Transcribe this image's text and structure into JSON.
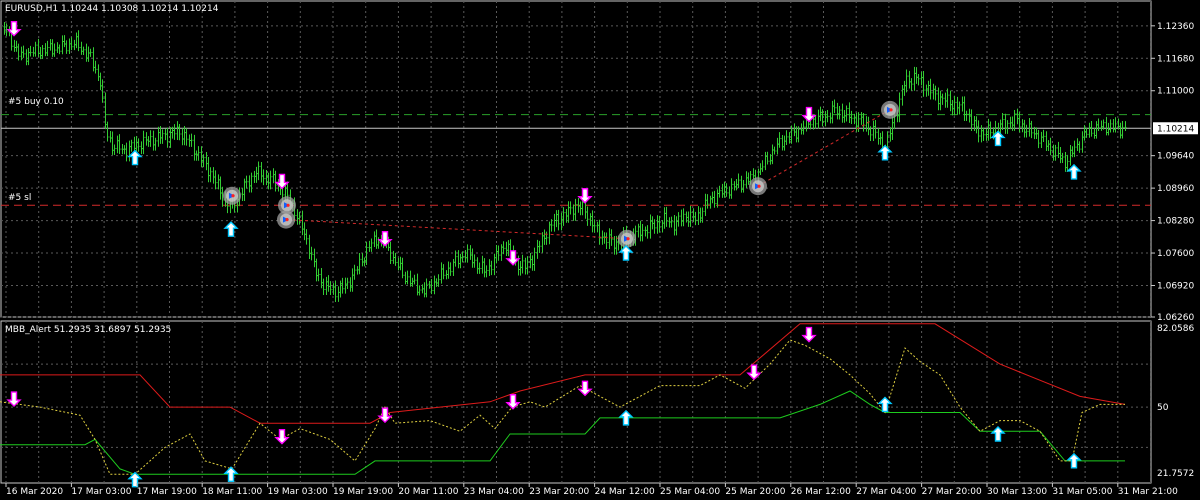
{
  "colors": {
    "background": "#000000",
    "grid": "#5a5a5a",
    "candles": "#33cc33",
    "buy_level": "#2aa02a",
    "sl_level": "#d42a2a",
    "price_line": "#c8c8c8",
    "upper_band": "#dd1b1b",
    "lower_band": "#1ecb1e",
    "signal_line": "#e0d040",
    "up_arrow": "#00c8ff",
    "down_arrow": "#ff00ff"
  },
  "chart_data": [
    {
      "type": "candlestick",
      "title": "EURUSD,H1  1.10244 1.10308 1.10214 1.10214",
      "current_price": 1.10214,
      "current_price_label": "1.10214",
      "ylim": [
        1.0626,
        1.1288
      ],
      "yticks": [
        1.0626,
        1.0692,
        1.076,
        1.0828,
        1.0896,
        1.0964,
        1.11,
        1.1168,
        1.1236
      ],
      "ytick_labels": [
        "1.06260",
        "1.06920",
        "1.07600",
        "1.08280",
        "1.08960",
        "1.09640",
        "1.11000",
        "1.11680",
        "1.12360"
      ],
      "xticks": [
        "16 Mar 2020",
        "17 Mar 03:00",
        "17 Mar 19:00",
        "18 Mar 11:00",
        "19 Mar 03:00",
        "19 Mar 19:00",
        "20 Mar 11:00",
        "23 Mar 04:00",
        "23 Mar 20:00",
        "24 Mar 12:00",
        "25 Mar 04:00",
        "25 Mar 20:00",
        "26 Mar 12:00",
        "27 Mar 04:00",
        "27 Mar 20:00",
        "30 Mar 13:00",
        "31 Mar 05:00",
        "31 Mar 21:00"
      ],
      "levels": [
        {
          "label": "#5 buy 0.10",
          "value": 1.105
        },
        {
          "label": "#5 sl",
          "value": 1.086
        }
      ],
      "close_path": [
        [
          0,
          1.124
        ],
        [
          10,
          1.121
        ],
        [
          20,
          1.117
        ],
        [
          30,
          1.118
        ],
        [
          45,
          1.1185
        ],
        [
          60,
          1.119
        ],
        [
          75,
          1.12
        ],
        [
          90,
          1.117
        ],
        [
          100,
          1.112
        ],
        [
          105,
          1.102
        ],
        [
          112,
          1.0985
        ],
        [
          125,
          1.0975
        ],
        [
          140,
          1.099
        ],
        [
          155,
          1.1
        ],
        [
          170,
          1.101
        ],
        [
          180,
          1.1015
        ],
        [
          190,
          1.099
        ],
        [
          200,
          1.096
        ],
        [
          210,
          1.093
        ],
        [
          220,
          1.089
        ],
        [
          228,
          1.086
        ],
        [
          235,
          1.087
        ],
        [
          245,
          1.09
        ],
        [
          255,
          1.093
        ],
        [
          265,
          1.092
        ],
        [
          275,
          1.091
        ],
        [
          283,
          1.089
        ],
        [
          292,
          1.086
        ],
        [
          300,
          1.082
        ],
        [
          308,
          1.078
        ],
        [
          315,
          1.072
        ],
        [
          325,
          1.069
        ],
        [
          335,
          1.068
        ],
        [
          345,
          1.069
        ],
        [
          355,
          1.072
        ],
        [
          365,
          1.076
        ],
        [
          375,
          1.079
        ],
        [
          385,
          1.078
        ],
        [
          395,
          1.074
        ],
        [
          405,
          1.071
        ],
        [
          415,
          1.069
        ],
        [
          425,
          1.068
        ],
        [
          435,
          1.07
        ],
        [
          445,
          1.072
        ],
        [
          455,
          1.074
        ],
        [
          465,
          1.076
        ],
        [
          475,
          1.074
        ],
        [
          485,
          1.072
        ],
        [
          495,
          1.075
        ],
        [
          505,
          1.078
        ],
        [
          515,
          1.074
        ],
        [
          525,
          1.073
        ],
        [
          535,
          1.076
        ],
        [
          545,
          1.08
        ],
        [
          555,
          1.083
        ],
        [
          565,
          1.084
        ],
        [
          575,
          1.086
        ],
        [
          585,
          1.085
        ],
        [
          595,
          1.081
        ],
        [
          605,
          1.079
        ],
        [
          615,
          1.078
        ],
        [
          625,
          1.079
        ],
        [
          635,
          1.08
        ],
        [
          645,
          1.081
        ],
        [
          655,
          1.082
        ],
        [
          665,
          1.083
        ],
        [
          675,
          1.082
        ],
        [
          685,
          1.084
        ],
        [
          695,
          1.083
        ],
        [
          705,
          1.086
        ],
        [
          715,
          1.088
        ],
        [
          725,
          1.089
        ],
        [
          735,
          1.09
        ],
        [
          745,
          1.091
        ],
        [
          755,
          1.092
        ],
        [
          765,
          1.095
        ],
        [
          775,
          1.098
        ],
        [
          785,
          1.1
        ],
        [
          795,
          1.101
        ],
        [
          805,
          1.103
        ],
        [
          815,
          1.104
        ],
        [
          825,
          1.1045
        ],
        [
          835,
          1.106
        ],
        [
          845,
          1.105
        ],
        [
          855,
          1.104
        ],
        [
          865,
          1.103
        ],
        [
          875,
          1.101
        ],
        [
          885,
          1.098
        ],
        [
          895,
          1.105
        ],
        [
          905,
          1.112
        ],
        [
          915,
          1.113
        ],
        [
          925,
          1.111
        ],
        [
          935,
          1.109
        ],
        [
          945,
          1.108
        ],
        [
          955,
          1.107
        ],
        [
          965,
          1.106
        ],
        [
          975,
          1.102
        ],
        [
          985,
          1.101
        ],
        [
          995,
          1.102
        ],
        [
          1005,
          1.103
        ],
        [
          1015,
          1.104
        ],
        [
          1025,
          1.102
        ],
        [
          1035,
          1.101
        ],
        [
          1045,
          1.099
        ],
        [
          1055,
          1.097
        ],
        [
          1065,
          1.095
        ],
        [
          1075,
          1.098
        ],
        [
          1085,
          1.101
        ],
        [
          1095,
          1.102
        ],
        [
          1105,
          1.1025
        ],
        [
          1115,
          1.1022
        ],
        [
          1125,
          1.1021
        ]
      ],
      "signals": [
        {
          "type": "down",
          "x": 14,
          "y": 1.123
        },
        {
          "type": "up",
          "x": 135,
          "y": 1.096
        },
        {
          "type": "up",
          "x": 231,
          "y": 1.081
        },
        {
          "type": "down",
          "x": 282,
          "y": 1.091
        },
        {
          "type": "down",
          "x": 385,
          "y": 1.079
        },
        {
          "type": "down",
          "x": 513,
          "y": 1.075
        },
        {
          "type": "down",
          "x": 585,
          "y": 1.088
        },
        {
          "type": "up",
          "x": 626,
          "y": 1.076
        },
        {
          "type": "down",
          "x": 809,
          "y": 1.105
        },
        {
          "type": "up",
          "x": 885,
          "y": 1.097
        },
        {
          "type": "up",
          "x": 998,
          "y": 1.1
        },
        {
          "type": "up",
          "x": 1074,
          "y": 1.093
        }
      ],
      "trades": [
        {
          "x": 232,
          "y": 1.088
        },
        {
          "x": 287,
          "y": 1.086
        },
        {
          "x": 286,
          "y": 1.083
        },
        {
          "x": 627,
          "y": 1.079
        },
        {
          "x": 758,
          "y": 1.09
        },
        {
          "x": 890,
          "y": 1.106
        }
      ],
      "trade_links": [
        [
          [
            287,
            1.083
          ],
          [
            627,
            1.079
          ]
        ],
        [
          [
            758,
            1.09
          ],
          [
            890,
            1.106
          ]
        ]
      ]
    },
    {
      "type": "line",
      "title": "MBB_Alert 51.2935 31.6897 51.2935",
      "ylim": [
        21.7572,
        82.0586
      ],
      "yticks": [
        21.7572,
        50,
        82.0586
      ],
      "ytick_labels": [
        "21.7572",
        "50",
        "82.0586"
      ],
      "series": [
        {
          "id": "upper",
          "values": [
            [
              0,
              62
            ],
            [
              140,
              62
            ],
            [
              170,
              50
            ],
            [
              230,
              50
            ],
            [
              260,
              44
            ],
            [
              370,
              44
            ],
            [
              390,
              48
            ],
            [
              490,
              52
            ],
            [
              520,
              56
            ],
            [
              585,
              62
            ],
            [
              740,
              62
            ],
            [
              800,
              81
            ],
            [
              935,
              81
            ],
            [
              1000,
              66
            ],
            [
              1080,
              54
            ],
            [
              1125,
              51
            ]
          ]
        },
        {
          "id": "lower",
          "values": [
            [
              0,
              36
            ],
            [
              85,
              36
            ],
            [
              95,
              38
            ],
            [
              120,
              27
            ],
            [
              135,
              25
            ],
            [
              280,
              25
            ],
            [
              355,
              25
            ],
            [
              375,
              30
            ],
            [
              490,
              30
            ],
            [
              510,
              40
            ],
            [
              585,
              40
            ],
            [
              600,
              46
            ],
            [
              780,
              46
            ],
            [
              820,
              51
            ],
            [
              850,
              56
            ],
            [
              870,
              51
            ],
            [
              885,
              48
            ],
            [
              960,
              48
            ],
            [
              980,
              41
            ],
            [
              1040,
              41
            ],
            [
              1065,
              30
            ],
            [
              1125,
              30
            ]
          ]
        },
        {
          "id": "signal",
          "values": [
            [
              0,
              52
            ],
            [
              40,
              50
            ],
            [
              80,
              47
            ],
            [
              95,
              38
            ],
            [
              110,
              25
            ],
            [
              135,
              25
            ],
            [
              165,
              35
            ],
            [
              190,
              40
            ],
            [
              205,
              30
            ],
            [
              232,
              27
            ],
            [
              260,
              44
            ],
            [
              280,
              38
            ],
            [
              300,
              42
            ],
            [
              330,
              38
            ],
            [
              355,
              30
            ],
            [
              375,
              42
            ],
            [
              385,
              50
            ],
            [
              395,
              44
            ],
            [
              430,
              45
            ],
            [
              460,
              41
            ],
            [
              480,
              47
            ],
            [
              495,
              42
            ],
            [
              512,
              50
            ],
            [
              530,
              52
            ],
            [
              545,
              50
            ],
            [
              580,
              58
            ],
            [
              600,
              54
            ],
            [
              620,
              50
            ],
            [
              660,
              58
            ],
            [
              700,
              58
            ],
            [
              720,
              62
            ],
            [
              745,
              57
            ],
            [
              770,
              66
            ],
            [
              790,
              75
            ],
            [
              805,
              73
            ],
            [
              830,
              68
            ],
            [
              850,
              62
            ],
            [
              870,
              55
            ],
            [
              885,
              48
            ],
            [
              905,
              72
            ],
            [
              920,
              67
            ],
            [
              940,
              62
            ],
            [
              960,
              50
            ],
            [
              980,
              41
            ],
            [
              1000,
              45
            ],
            [
              1020,
              45
            ],
            [
              1040,
              41
            ],
            [
              1060,
              30
            ],
            [
              1072,
              30
            ],
            [
              1082,
              48
            ],
            [
              1100,
              51
            ],
            [
              1125,
              51
            ]
          ]
        }
      ],
      "signals": [
        {
          "type": "down",
          "x": 14,
          "y": 53
        },
        {
          "type": "up",
          "x": 135,
          "y": 23
        },
        {
          "type": "up",
          "x": 231,
          "y": 25
        },
        {
          "type": "down",
          "x": 282,
          "y": 39
        },
        {
          "type": "down",
          "x": 385,
          "y": 47
        },
        {
          "type": "down",
          "x": 513,
          "y": 52
        },
        {
          "type": "down",
          "x": 585,
          "y": 57
        },
        {
          "type": "up",
          "x": 626,
          "y": 46
        },
        {
          "type": "down",
          "x": 754,
          "y": 63
        },
        {
          "type": "down",
          "x": 809,
          "y": 77
        },
        {
          "type": "up",
          "x": 885,
          "y": 51
        },
        {
          "type": "up",
          "x": 998,
          "y": 40
        },
        {
          "type": "up",
          "x": 1074,
          "y": 30
        }
      ]
    }
  ]
}
